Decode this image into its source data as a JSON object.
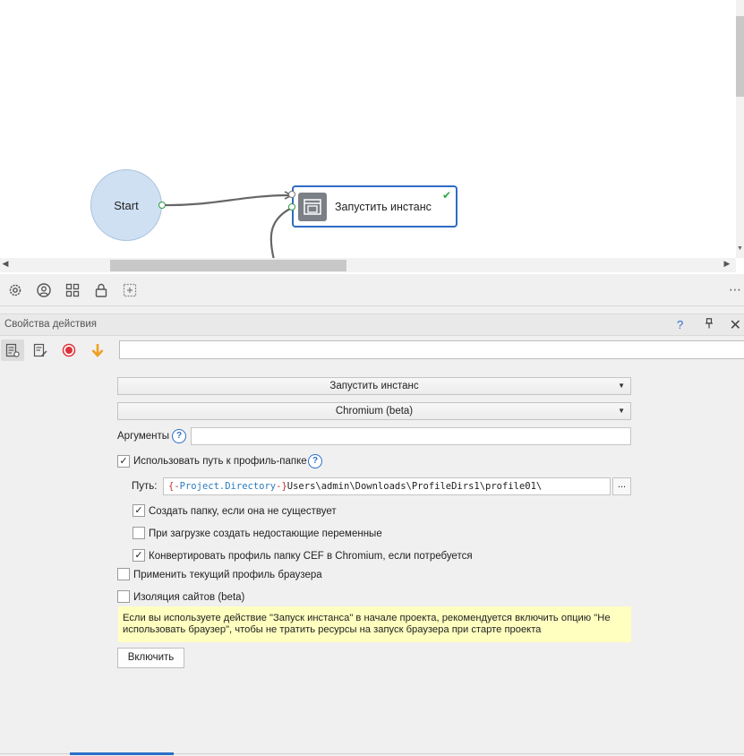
{
  "canvas": {
    "start_node": {
      "label": "Start"
    },
    "action_node": {
      "label": "Запустить инстанс",
      "status_icon": "check-icon",
      "icon": "window-instance-icon"
    }
  },
  "toolbar": {
    "icons": [
      "gear-icon",
      "user-circle-icon",
      "grid-icon",
      "lock-icon",
      "add-box-icon"
    ],
    "more_label": "⋯"
  },
  "properties": {
    "title": "Свойства действия",
    "help_label": "?",
    "pin_icon": "pin-icon",
    "close_label": "✕",
    "toolbar_icons": [
      "properties-icon",
      "edit-icon",
      "record-icon",
      "arrow-down-icon"
    ],
    "action_combo": "Запустить инстанс",
    "browser_combo": "Chromium (beta)",
    "arguments_label": "Аргументы",
    "arguments_value": "",
    "help_q": "?",
    "use_profile_path": {
      "label": "Использовать путь к профиль-папке",
      "checked": true
    },
    "path_label": "Путь:",
    "path": {
      "brace_open": "{-",
      "var": "Project.Directory",
      "brace_close": "-}",
      "rest": "Users\\admin\\Downloads\\ProfileDirs1\\profile01\\"
    },
    "browse_label": "...",
    "create_folder": {
      "label": "Создать папку, если она не существует",
      "checked": true
    },
    "create_vars": {
      "label": "При загрузке создать недостающие переменные",
      "checked": false
    },
    "convert_cef": {
      "label": "Конвертировать профиль папку CEF в Chromium, если потребуется",
      "checked": true
    },
    "apply_current": {
      "label": "Применить текущий профиль браузера",
      "checked": false
    },
    "site_isolation": {
      "label": "Изоляция сайтов (beta)",
      "checked": false
    },
    "note": "Если вы используете действие \"Запуск инстанса\" в начале проекта, рекомендуется включить опцию \"Не использовать браузер\", чтобы не тратить ресурсы на запуск браузера при старте проекта",
    "enable_button": "Включить",
    "check_mark": "✓"
  }
}
